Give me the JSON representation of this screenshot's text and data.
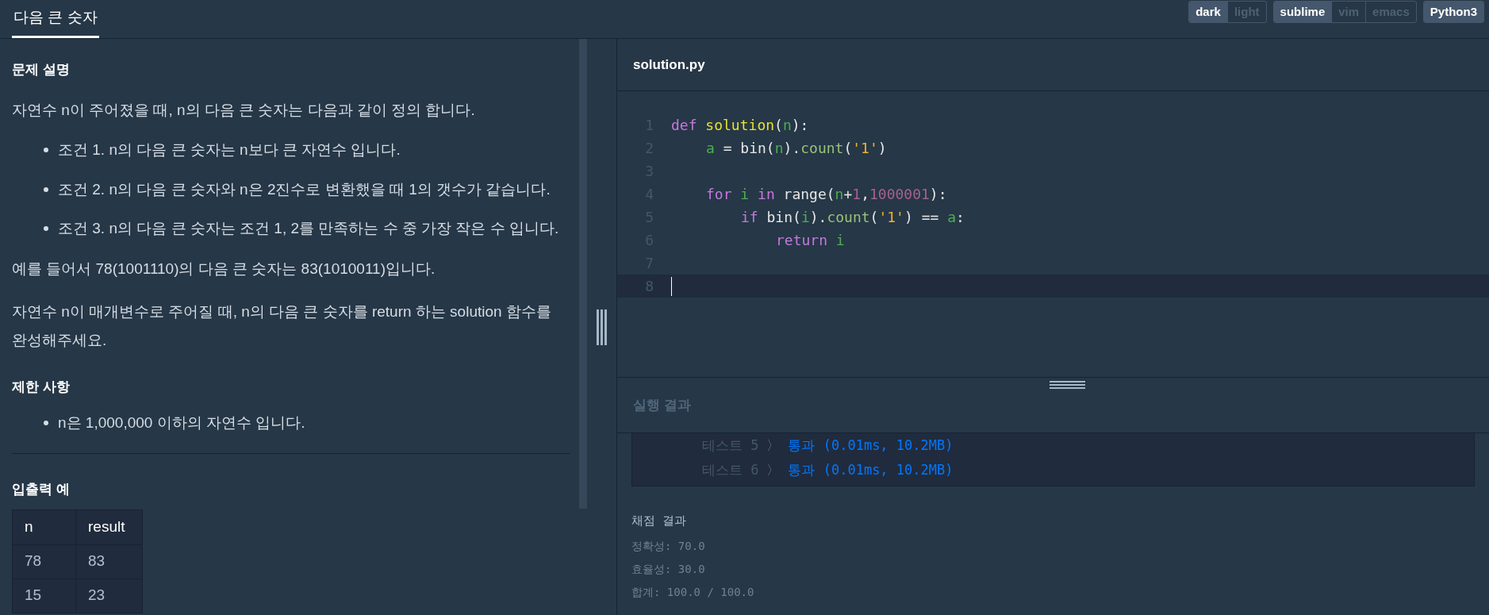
{
  "title_tab": {
    "label": "다음 큰 숫자",
    "selected": true
  },
  "toolbar": [
    [
      {
        "label": "dark",
        "selected": true
      },
      {
        "label": "light",
        "selected": false
      }
    ],
    [
      {
        "label": "sublime",
        "selected": true
      },
      {
        "label": "vim",
        "selected": false
      },
      {
        "label": "emacs",
        "selected": false
      }
    ],
    [
      {
        "label": "Python3",
        "selected": true
      }
    ]
  ],
  "problem": {
    "heading": "문제 설명",
    "intro": "자연수 n이 주어졌을 때, n의 다음 큰 숫자는 다음과 같이 정의 합니다.",
    "conditions": [
      "조건 1. n의 다음 큰 숫자는 n보다 큰 자연수 입니다.",
      "조건 2. n의 다음 큰 숫자와 n은 2진수로 변환했을 때 1의 갯수가 같습니다.",
      "조건 3. n의 다음 큰 숫자는 조건 1, 2를 만족하는 수 중 가장 작은 수 입니다."
    ],
    "example_text": "예를 들어서 78(1001110)의 다음 큰 숫자는 83(1010011)입니다.",
    "task": "자연수 n이 매개변수로 주어질 때, n의 다음 큰 숫자를 return 하는 solution 함수를 완성해주세요.",
    "limits_heading": "제한 사항",
    "limits": [
      "n은 1,000,000 이하의 자연수 입니다."
    ],
    "io_heading": "입출력 예",
    "table": {
      "columns": [
        "n",
        "result"
      ],
      "rows": [
        [
          "78",
          "83"
        ],
        [
          "15",
          "23"
        ]
      ]
    }
  },
  "editor": {
    "filename": "solution.py",
    "lines": [
      {
        "number": "1",
        "tokens": [
          {
            "t": "def ",
            "kind": "keyword"
          },
          {
            "t": "solution",
            "kind": "function"
          },
          {
            "t": "(",
            "kind": "plain"
          },
          {
            "t": "n",
            "kind": "variable"
          },
          {
            "t": "):",
            "kind": "plain"
          }
        ],
        "children": [
          {
            "number": "2",
            "tokens": [
              {
                "t": "a",
                "kind": "variable"
              },
              {
                "t": " = bin(",
                "kind": "plain"
              },
              {
                "t": "n",
                "kind": "variable"
              },
              {
                "t": ").",
                "kind": "plain"
              },
              {
                "t": "count",
                "kind": "method"
              },
              {
                "t": "(",
                "kind": "plain"
              },
              {
                "t": "'1'",
                "kind": "string"
              },
              {
                "t": ")",
                "kind": "plain"
              }
            ]
          },
          {
            "number": "3"
          },
          {
            "number": "4",
            "tokens": [
              {
                "t": "for ",
                "kind": "keyword"
              },
              {
                "t": "i ",
                "kind": "variable"
              },
              {
                "t": "in ",
                "kind": "keyword"
              },
              {
                "t": "range(",
                "kind": "plain"
              },
              {
                "t": "n",
                "kind": "variable"
              },
              {
                "t": "+",
                "kind": "plain"
              },
              {
                "t": "1",
                "kind": "number"
              },
              {
                "t": ",",
                "kind": "plain"
              },
              {
                "t": "1000001",
                "kind": "number"
              },
              {
                "t": "):",
                "kind": "plain"
              }
            ],
            "children": [
              {
                "number": "5",
                "tokens": [
                  {
                    "t": "if ",
                    "kind": "keyword"
                  },
                  {
                    "t": "bin(",
                    "kind": "plain"
                  },
                  {
                    "t": "i",
                    "kind": "variable"
                  },
                  {
                    "t": ").",
                    "kind": "plain"
                  },
                  {
                    "t": "count",
                    "kind": "method"
                  },
                  {
                    "t": "(",
                    "kind": "plain"
                  },
                  {
                    "t": "'1'",
                    "kind": "string"
                  },
                  {
                    "t": ") == ",
                    "kind": "plain"
                  },
                  {
                    "t": "a",
                    "kind": "variable"
                  },
                  {
                    "t": ":",
                    "kind": "plain"
                  }
                ],
                "children": [
                  {
                    "number": "6",
                    "tokens": [
                      {
                        "t": "return ",
                        "kind": "keyword"
                      },
                      {
                        "t": "i",
                        "kind": "variable"
                      }
                    ]
                  }
                ]
              }
            ]
          }
        ]
      },
      {
        "number": "7"
      },
      {
        "number": "8",
        "cursor": true
      }
    ]
  },
  "results": {
    "heading": "실행 결과",
    "tests": [
      {
        "name": "테스트 5",
        "arrow": "〉",
        "result": "통과 (0.01ms, 10.2MB)"
      },
      {
        "name": "테스트 6",
        "arrow": "〉",
        "result": "통과 (0.01ms, 10.2MB)"
      }
    ],
    "grading_heading": "채점 결과",
    "scores": [
      "정확성: 70.0",
      "효율성: 30.0",
      "합계: 100.0 / 100.0"
    ]
  }
}
